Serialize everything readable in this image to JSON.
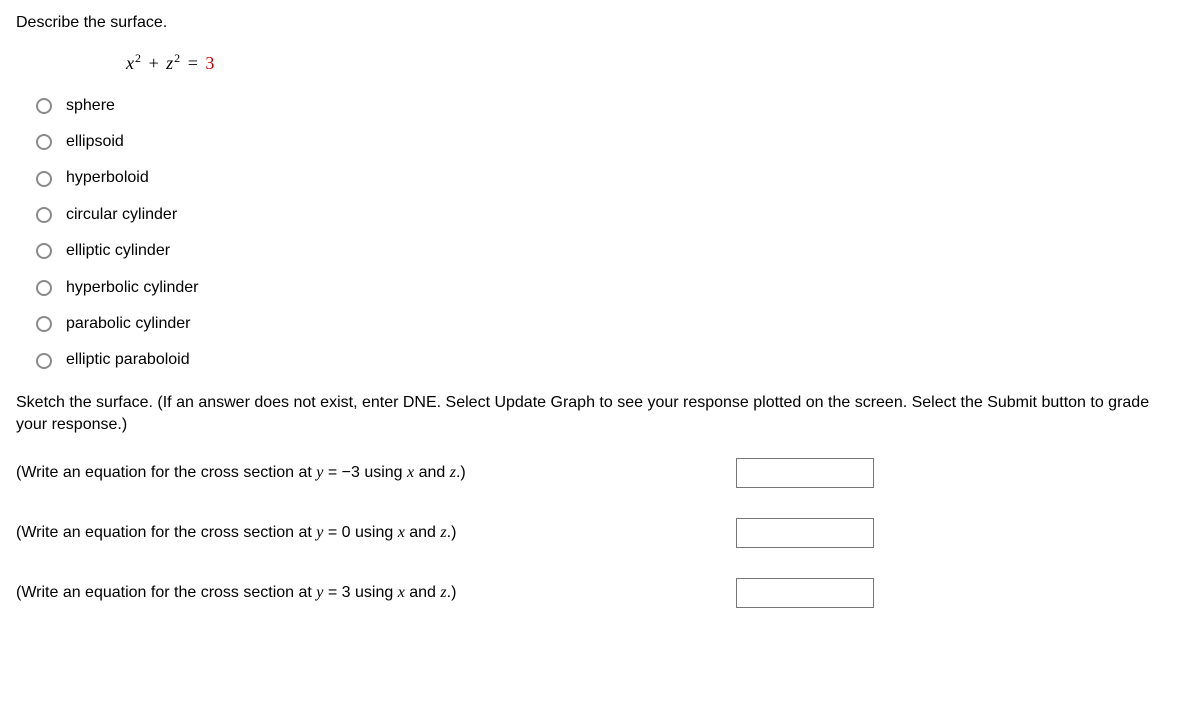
{
  "prompt": "Describe the surface.",
  "equation": {
    "lhs_html": "x<sup>2</sup> + z<sup>2</sup> = ",
    "rhs": "3"
  },
  "options": [
    "sphere",
    "ellipsoid",
    "hyperboloid",
    "circular cylinder",
    "elliptic cylinder",
    "hyperbolic cylinder",
    "parabolic cylinder",
    "elliptic paraboloid"
  ],
  "sketch_instruction": "Sketch the surface. (If an answer does not exist, enter DNE. Select Update Graph to see your response plotted on the screen. Select the Submit button to grade your response.)",
  "cross_sections": [
    {
      "prefix": "(Write an equation for the cross section at ",
      "var": "y",
      "eq": " = −3 using ",
      "v1": "x",
      "and": " and ",
      "v2": "z",
      "suffix": ".)"
    },
    {
      "prefix": "(Write an equation for the cross section at ",
      "var": "y",
      "eq": " = 0 using ",
      "v1": "x",
      "and": " and ",
      "v2": "z",
      "suffix": ".)"
    },
    {
      "prefix": "(Write an equation for the cross section at ",
      "var": "y",
      "eq": " = 3 using ",
      "v1": "x",
      "and": " and ",
      "v2": "z",
      "suffix": ".)"
    }
  ]
}
